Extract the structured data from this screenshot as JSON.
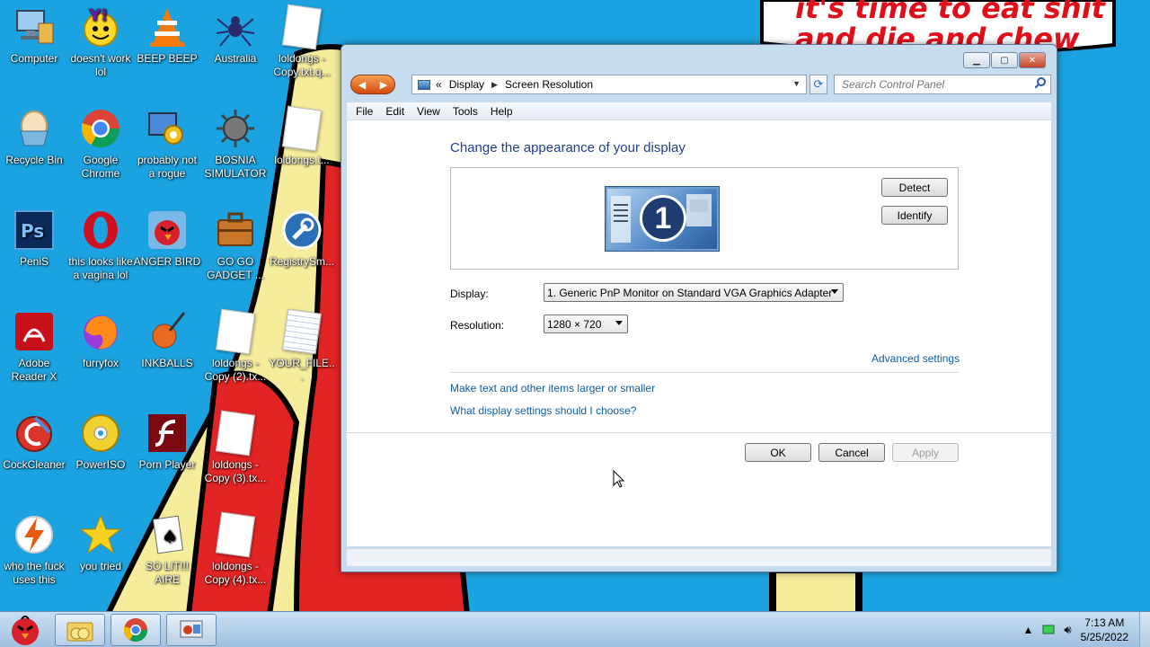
{
  "wallpaper": {
    "speech_line1": "it's time to eat shit",
    "speech_line2": "and die and chew"
  },
  "desktop_icons": [
    {
      "label": "Computer"
    },
    {
      "label": "doesn't work lol"
    },
    {
      "label": "BEEP BEEP"
    },
    {
      "label": "Australia"
    },
    {
      "label": "loldongs - Copy.txt.q..."
    },
    {
      "label": "Recycle Bin"
    },
    {
      "label": "Google Chrome"
    },
    {
      "label": "probably not a rogue"
    },
    {
      "label": "BOSNIA SIMULATOR"
    },
    {
      "label": "loldongs.t..."
    },
    {
      "label": "PeniS"
    },
    {
      "label": "this looks like a vagina lol"
    },
    {
      "label": "ANGER BIRD"
    },
    {
      "label": "GO GO GADGET ..."
    },
    {
      "label": "RegistrySm..."
    },
    {
      "label": "Adobe Reader X"
    },
    {
      "label": "furryfox"
    },
    {
      "label": "INKBALLS"
    },
    {
      "label": "loldongs - Copy (2).tx..."
    },
    {
      "label": "YOUR_FILE..."
    },
    {
      "label": "CockCleaner"
    },
    {
      "label": "PowerISO"
    },
    {
      "label": "Porn Player"
    },
    {
      "label": "loldongs - Copy (3).tx..."
    },
    {
      "label": "who the fuck uses this"
    },
    {
      "label": "you tried"
    },
    {
      "label": "SO LIT!!! AIRE"
    },
    {
      "label": "loldongs - Copy (4).tx..."
    }
  ],
  "window": {
    "breadcrumb": {
      "prefix": "«",
      "level1": "Display",
      "level2": "Screen Resolution"
    },
    "search_placeholder": "Search Control Panel",
    "menu": [
      "File",
      "Edit",
      "View",
      "Tools",
      "Help"
    ],
    "page_title": "Change the appearance of your display",
    "monitor_number": "1",
    "detect_label": "Detect",
    "identify_label": "Identify",
    "display_label": "Display:",
    "display_value": "1. Generic PnP Monitor on Standard VGA Graphics Adapter",
    "resolution_label": "Resolution:",
    "resolution_value": "1280 × 720",
    "advanced_link": "Advanced settings",
    "link_text_size": "Make text and other items larger or smaller",
    "link_help": "What display settings should I choose?",
    "ok_label": "OK",
    "cancel_label": "Cancel",
    "apply_label": "Apply"
  },
  "taskbar": {
    "time": "7:13 AM",
    "date": "5/25/2022"
  },
  "colors": {
    "desktop_bg": "#1aa3e0",
    "title_blue": "#1e3f8a",
    "link_blue": "#0b5fa5"
  }
}
